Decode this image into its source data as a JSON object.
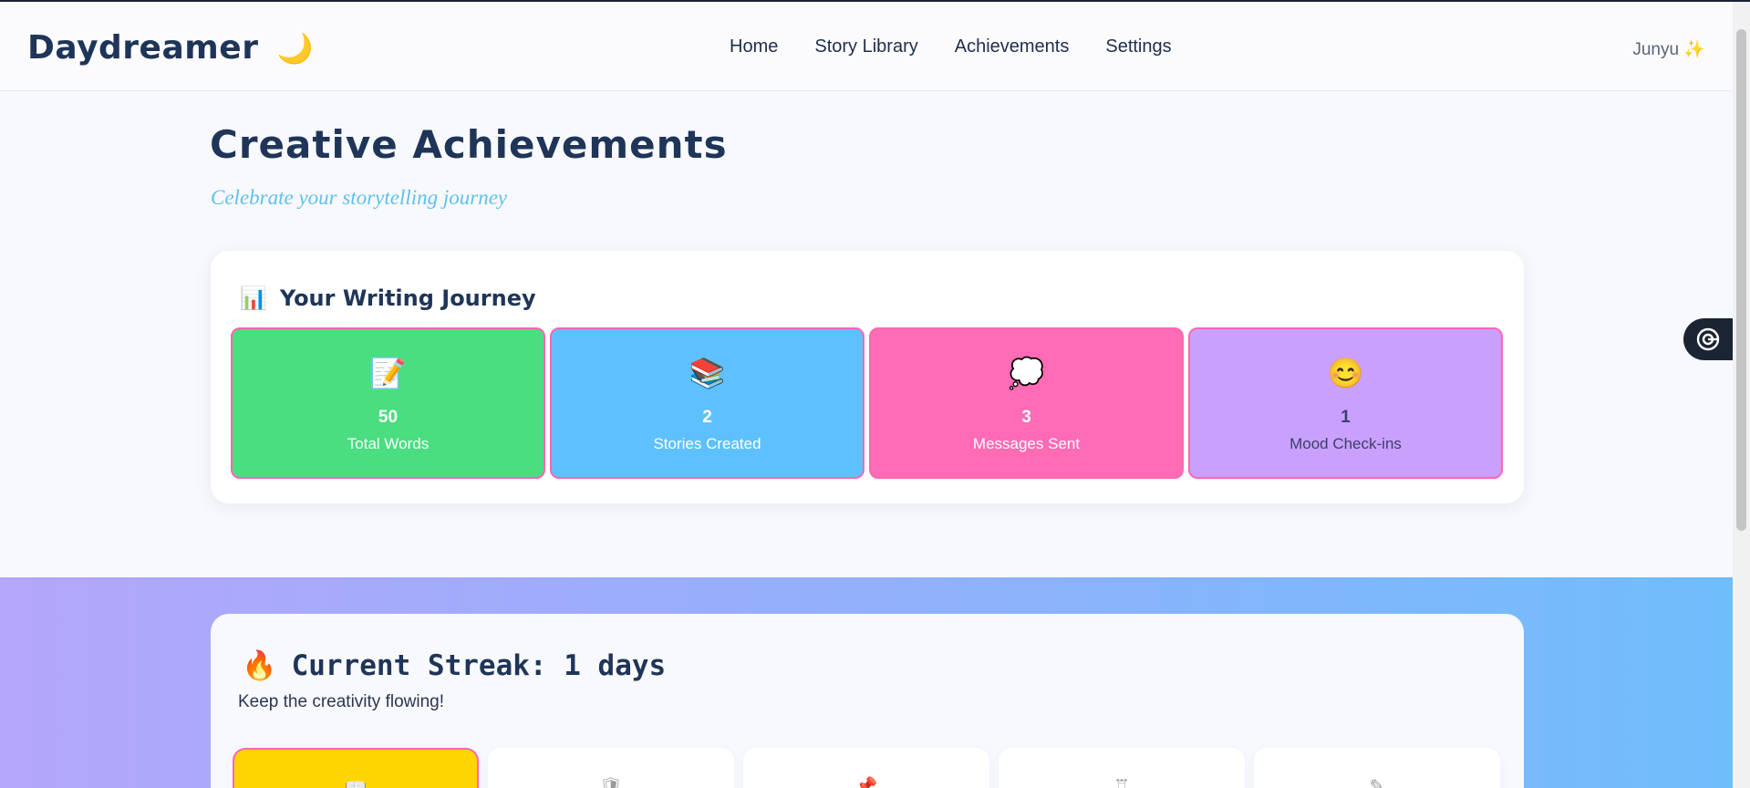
{
  "app": {
    "brand": "Daydreamer",
    "brand_icon": "🌙"
  },
  "nav": {
    "links": [
      "Home",
      "Story Library",
      "Achievements",
      "Settings"
    ]
  },
  "user": {
    "name": "Junyu",
    "icon": "✨"
  },
  "page": {
    "title": "Creative Achievements",
    "subtitle": "Celebrate your storytelling journey"
  },
  "journey": {
    "icon": "📊",
    "title": "Your Writing Journey",
    "stats": [
      {
        "icon": "📝",
        "value": "50",
        "label": "Total Words",
        "color": "#4ade80"
      },
      {
        "icon": "📚",
        "value": "2",
        "label": "Stories Created",
        "color": "#5ec1fd"
      },
      {
        "icon": "💭",
        "value": "3",
        "label": "Messages Sent",
        "color": "#ff6bb5"
      },
      {
        "icon": "😊",
        "value": "1",
        "label": "Mood Check-ins",
        "color": "#c9a0fd"
      }
    ]
  },
  "streak": {
    "icon": "🔥",
    "title": "Current Streak: 1 days",
    "subtitle": "Keep the creativity flowing!",
    "badges": [
      {
        "icon": "📖",
        "active": true
      },
      {
        "icon": "🛡",
        "active": false
      },
      {
        "icon": "📌",
        "active": false
      },
      {
        "icon": "♖",
        "active": false
      },
      {
        "icon": "✎",
        "active": false
      }
    ]
  },
  "colors": {
    "accent_pink": "#ff66b3",
    "title_navy": "#1f3558",
    "subtitle_blue": "#5fc0ec"
  }
}
